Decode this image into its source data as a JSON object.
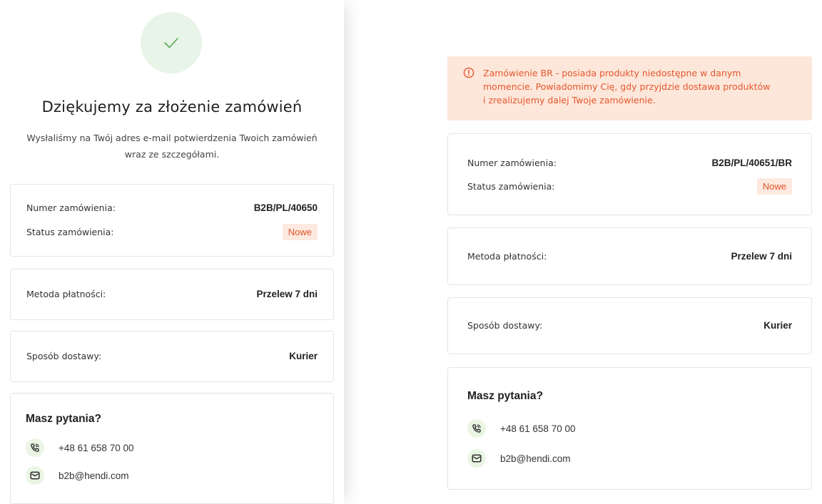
{
  "left": {
    "title": "Dziękujemy za złożenie zamówień",
    "subtitle_line1": "Wysłaliśmy na Twój adres e-mail potwierdzenia Twoich zamówień",
    "subtitle_line2": "wraz ze szczegółami.",
    "order": {
      "number_label": "Numer zamówienia:",
      "number_value": "B2B/PL/40650",
      "status_label": "Status zamówienia:",
      "status_value": "Nowe"
    },
    "payment": {
      "label": "Metoda płatności:",
      "value": "Przelew 7 dni"
    },
    "delivery": {
      "label": "Sposób dostawy:",
      "value": "Kurier"
    },
    "contact": {
      "title": "Masz pytania?",
      "phone": "+48 61 658 70 00",
      "email": "b2b@hendi.com"
    }
  },
  "right": {
    "alert": {
      "line1": "Zamówienie BR - posiada produkty niedostępne w danym",
      "line2": "momencie. Powiadomimy Cię, gdy przyjdzie dostawa produktów",
      "line3": "i zrealizujemy dalej Twoje zamówienie."
    },
    "order": {
      "number_label": "Numer zamówienia:",
      "number_value": "B2B/PL/40651/BR",
      "status_label": "Status zamówienia:",
      "status_value": "Nowe"
    },
    "payment": {
      "label": "Metoda płatności:",
      "value": "Przelew 7 dni"
    },
    "delivery": {
      "label": "Sposób dostawy:",
      "value": "Kurier"
    },
    "contact": {
      "title": "Masz pytania?",
      "phone": "+48 61 658 70 00",
      "email": "b2b@hendi.com"
    }
  },
  "colors": {
    "accent_green": "#5aa85a",
    "badge_bg": "#fde9df",
    "badge_text": "#e2552a",
    "alert_bg": "#fde7da",
    "alert_text": "#e4572e"
  },
  "icons": [
    "check-icon",
    "phone-icon",
    "mail-icon",
    "info-icon"
  ]
}
